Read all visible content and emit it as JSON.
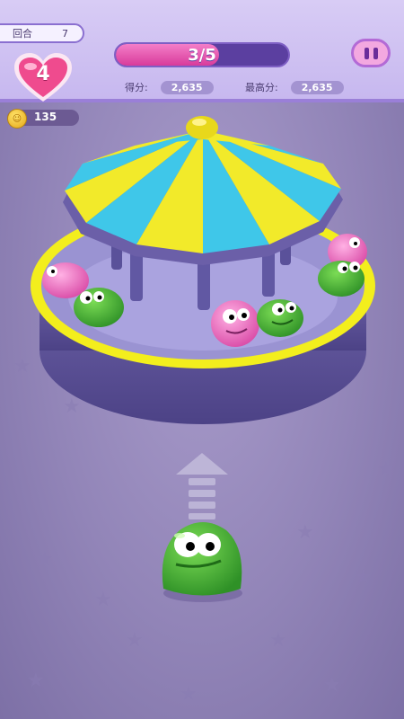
{
  "hud": {
    "round_label": "回合",
    "round_value": "7",
    "progress_text": "3/5",
    "progress_fraction": 0.6,
    "lives": "4",
    "score_label": "得分:",
    "score_value": "2,635",
    "best_label": "最高分:",
    "best_value": "2,635",
    "coins": "135"
  },
  "icons": {
    "lives": "heart-icon",
    "coins": "coin-icon",
    "pause": "pause-icon",
    "direction": "up-arrow-icon"
  },
  "colors": {
    "canopy_yellow": "#f2ea2a",
    "canopy_blue": "#3fc7e9",
    "jelly_green": "#45b33a",
    "jelly_pink": "#f275c5",
    "platform_purple": "#8b84c7"
  }
}
